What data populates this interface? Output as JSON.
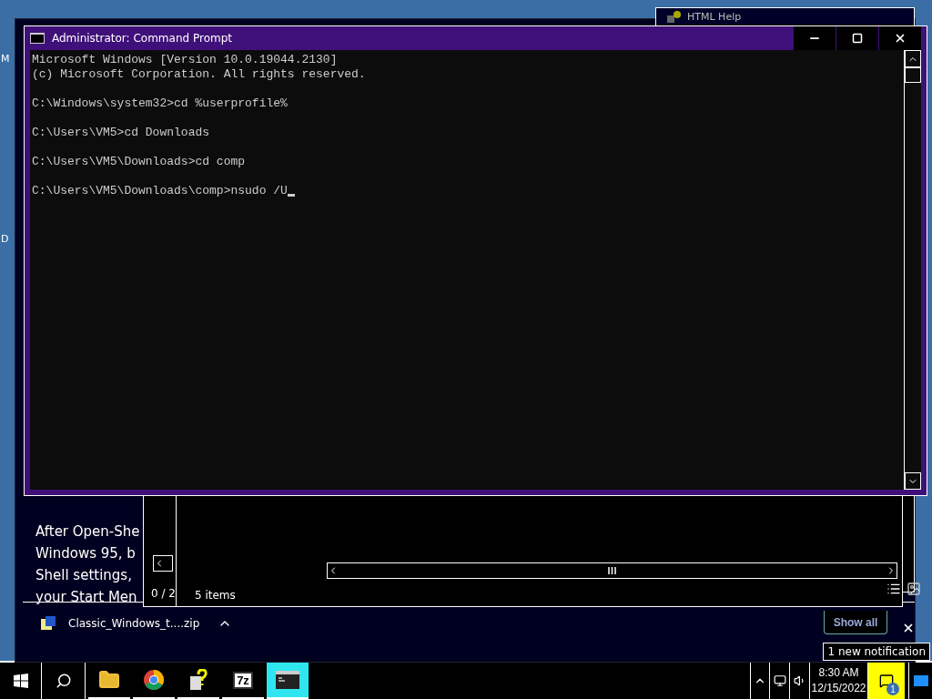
{
  "desktop_fragments": [
    "M",
    "D"
  ],
  "help_window": {
    "title": "HTML Help"
  },
  "browser_window": {
    "article_lines": [
      "After Open-She",
      "Windows 95, b",
      "Shell settings,",
      "your Start Men"
    ],
    "download": {
      "file": "Classic_Windows_t....zip"
    }
  },
  "explorer_window": {
    "pager": "0 / 2",
    "status": "5 items"
  },
  "cmd": {
    "title": "Administrator: Command Prompt",
    "blocks": [
      [
        "Microsoft Windows [Version 10.0.19044.2130]",
        "(c) Microsoft Corporation. All rights reserved."
      ],
      [
        "C:\\Windows\\system32>cd %userprofile%"
      ],
      [
        "C:\\Users\\VM5>cd Downloads"
      ],
      [
        "C:\\Users\\VM5\\Downloads>cd comp"
      ],
      [
        "C:\\Users\\VM5\\Downloads\\comp>nsudo /U"
      ]
    ]
  },
  "notification": {
    "button": "Show all",
    "tooltip": "1 new notification",
    "badge": "1"
  },
  "taskbar": {
    "apps": [
      {
        "kind": "explorer",
        "selected": false
      },
      {
        "kind": "chrome",
        "selected": false
      },
      {
        "kind": "help",
        "selected": false
      },
      {
        "kind": "archiver",
        "label": "7z",
        "selected": false
      },
      {
        "kind": "terminal",
        "selected": true
      }
    ],
    "time": "8:30 AM",
    "date": "12/15/2022"
  }
}
